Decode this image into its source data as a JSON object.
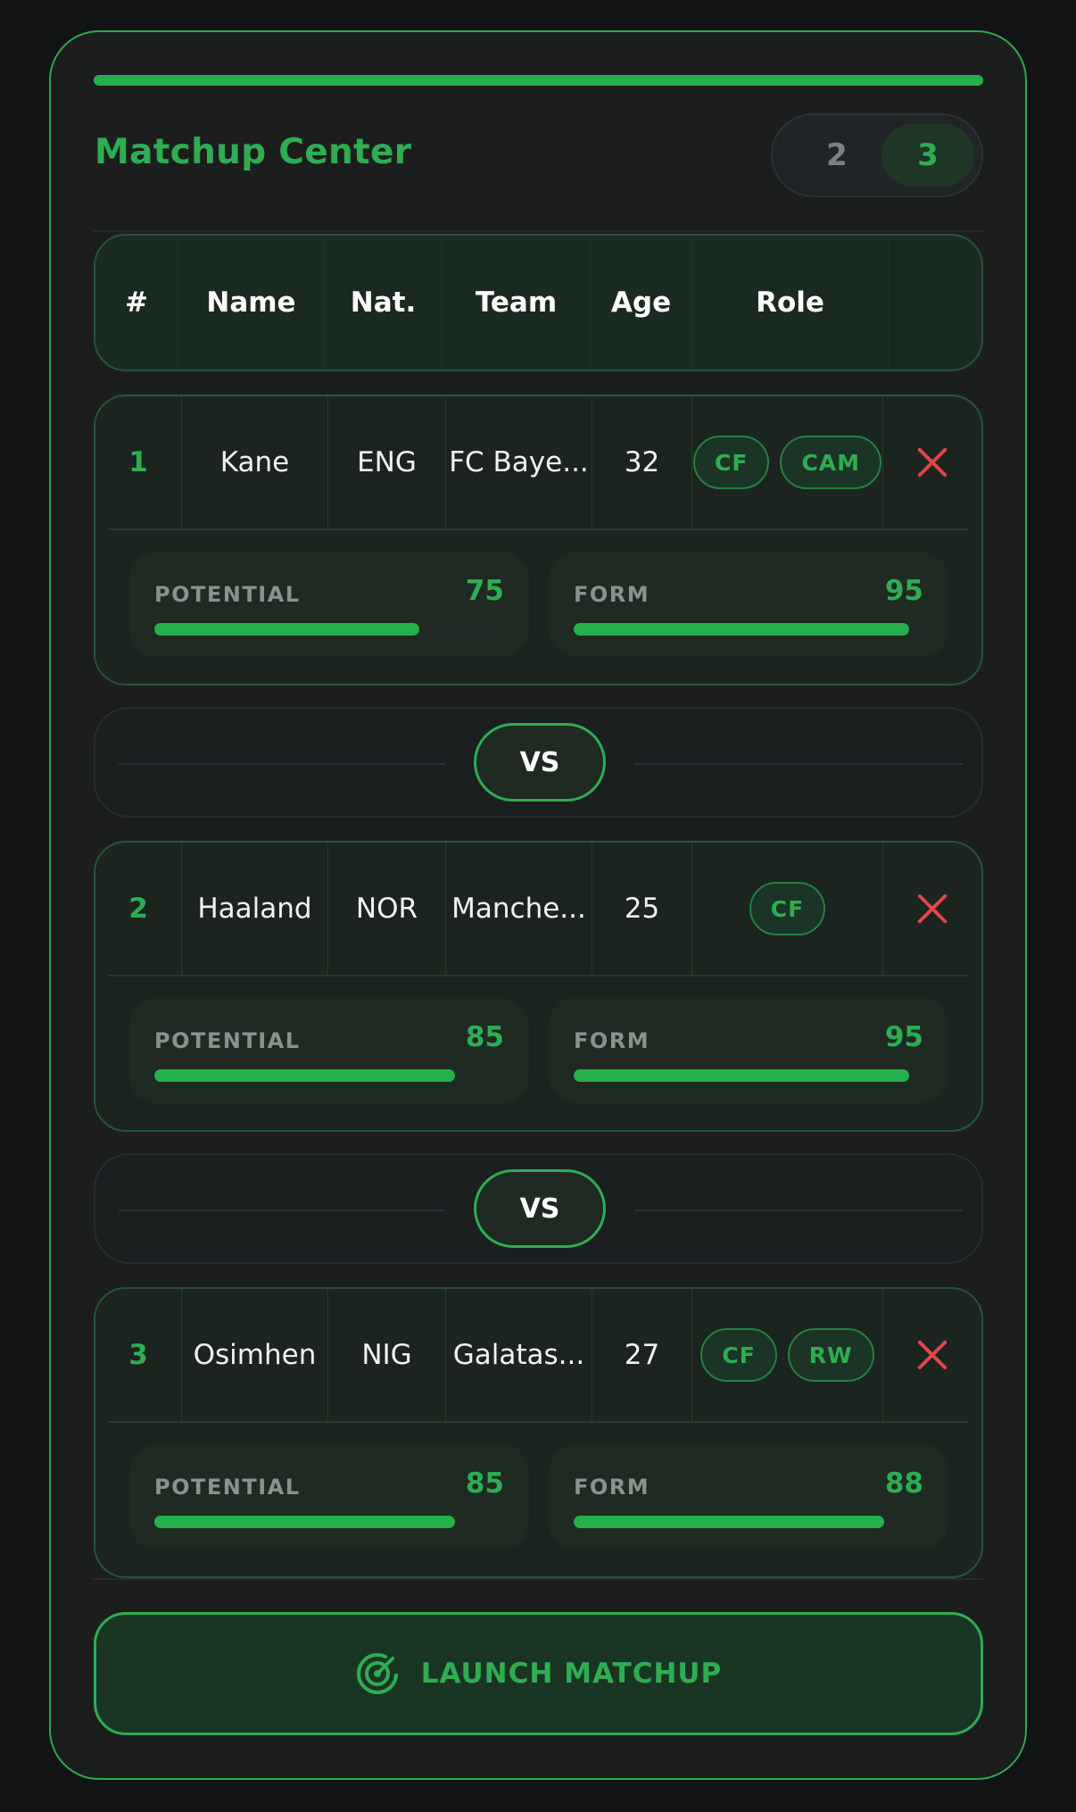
{
  "header": {
    "title": "Matchup Center",
    "segment_options": [
      "2",
      "3"
    ],
    "selected_segment": "3"
  },
  "table_header": [
    "#",
    "Name",
    "Nat.",
    "Team",
    "Age",
    "Role",
    ""
  ],
  "players": [
    {
      "rank": "1",
      "name": "Kane",
      "nat": "ENG",
      "team": "FC Baye...",
      "age": "32",
      "roles": [
        "CF",
        "CAM"
      ],
      "potential_label": "POTENTIAL",
      "potential": 75,
      "form_label": "FORM",
      "form": 95
    },
    {
      "rank": "2",
      "name": "Haaland",
      "nat": "NOR",
      "team": "Manche...",
      "age": "25",
      "roles": [
        "CF"
      ],
      "potential_label": "POTENTIAL",
      "potential": 85,
      "form_label": "FORM",
      "form": 95
    },
    {
      "rank": "3",
      "name": "Osimhen",
      "nat": "NIG",
      "team": "Galatas...",
      "age": "27",
      "roles": [
        "CF",
        "RW"
      ],
      "potential_label": "POTENTIAL",
      "potential": 85,
      "form_label": "FORM",
      "form": 88
    }
  ],
  "vs_label": "VS",
  "launch": {
    "label": "LAUNCH MATCHUP",
    "icon": "radar-icon"
  },
  "colors": {
    "accent": "#2ead52",
    "remove": "#e0474b",
    "background": "#111315"
  }
}
